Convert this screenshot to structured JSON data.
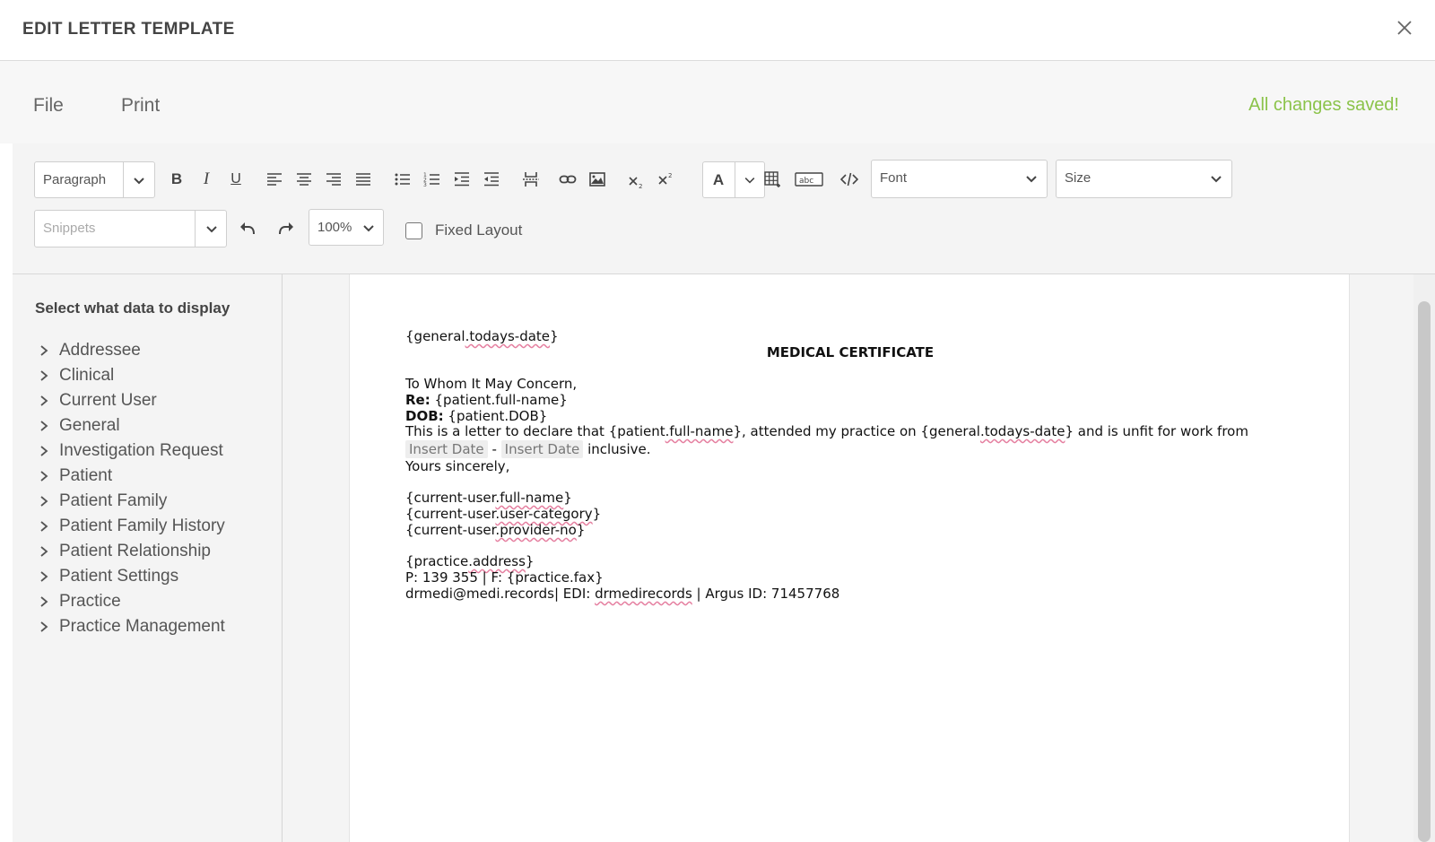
{
  "modal": {
    "title": "EDIT LETTER TEMPLATE"
  },
  "menubar": {
    "file": "File",
    "print": "Print",
    "status": "All changes saved!"
  },
  "toolbar": {
    "paragraph": "Paragraph",
    "font": "Font",
    "size": "Size",
    "snippets": "Snippets",
    "zoom": "100%",
    "fixed_layout": "Fixed Layout",
    "bold": "B",
    "italic": "I",
    "underline": "U",
    "font_color": "A"
  },
  "sidebar": {
    "title": "Select what data to display",
    "items": [
      {
        "label": "Addressee"
      },
      {
        "label": "Clinical"
      },
      {
        "label": "Current User"
      },
      {
        "label": "General"
      },
      {
        "label": "Investigation Request"
      },
      {
        "label": "Patient"
      },
      {
        "label": "Patient Family"
      },
      {
        "label": "Patient Family History"
      },
      {
        "label": "Patient Relationship"
      },
      {
        "label": "Patient Settings"
      },
      {
        "label": "Practice"
      },
      {
        "label": "Practice Management"
      }
    ]
  },
  "letter": {
    "date_pre": "{general",
    "date_field": ".todays-date",
    "date_post": "}",
    "heading": "MEDICAL CERTIFICATE",
    "greeting": "To Whom It May Concern,",
    "re_label": "Re:",
    "re_value": "{patient.full-name}",
    "dob_label": "DOB:",
    "dob_value": "{patient.DOB}",
    "body_1": "This is a letter to declare that {patient",
    "body_2": ".full-name",
    "body_3": "}, attended my practice on {general",
    "body_4": ".todays-date",
    "body_5": "} and is unfit for work from",
    "insert_date_1": "Insert Date",
    "dash": "-",
    "insert_date_2": "Insert Date",
    "inclusive": "inclusive.",
    "signoff": "Yours sincerely,",
    "user_name_pre": "{current-user",
    "user_name_field": ".full-name",
    "user_name_post": "}",
    "user_cat_pre": "{current-user",
    "user_cat_field": ".user-category",
    "user_cat_post": "}",
    "user_prov_pre": "{current-user",
    "user_prov_field": ".provider-no",
    "user_prov_post": "}",
    "addr_pre": "{practice",
    "addr_field": ".address",
    "addr_post": "}",
    "phone_line": "P: 139 355 | F: {practice.fax}",
    "email_pre": "drmedi@medi.records| EDI: ",
    "email_edi": "drmedirecords",
    "email_post": " | Argus ID: 71457768"
  }
}
